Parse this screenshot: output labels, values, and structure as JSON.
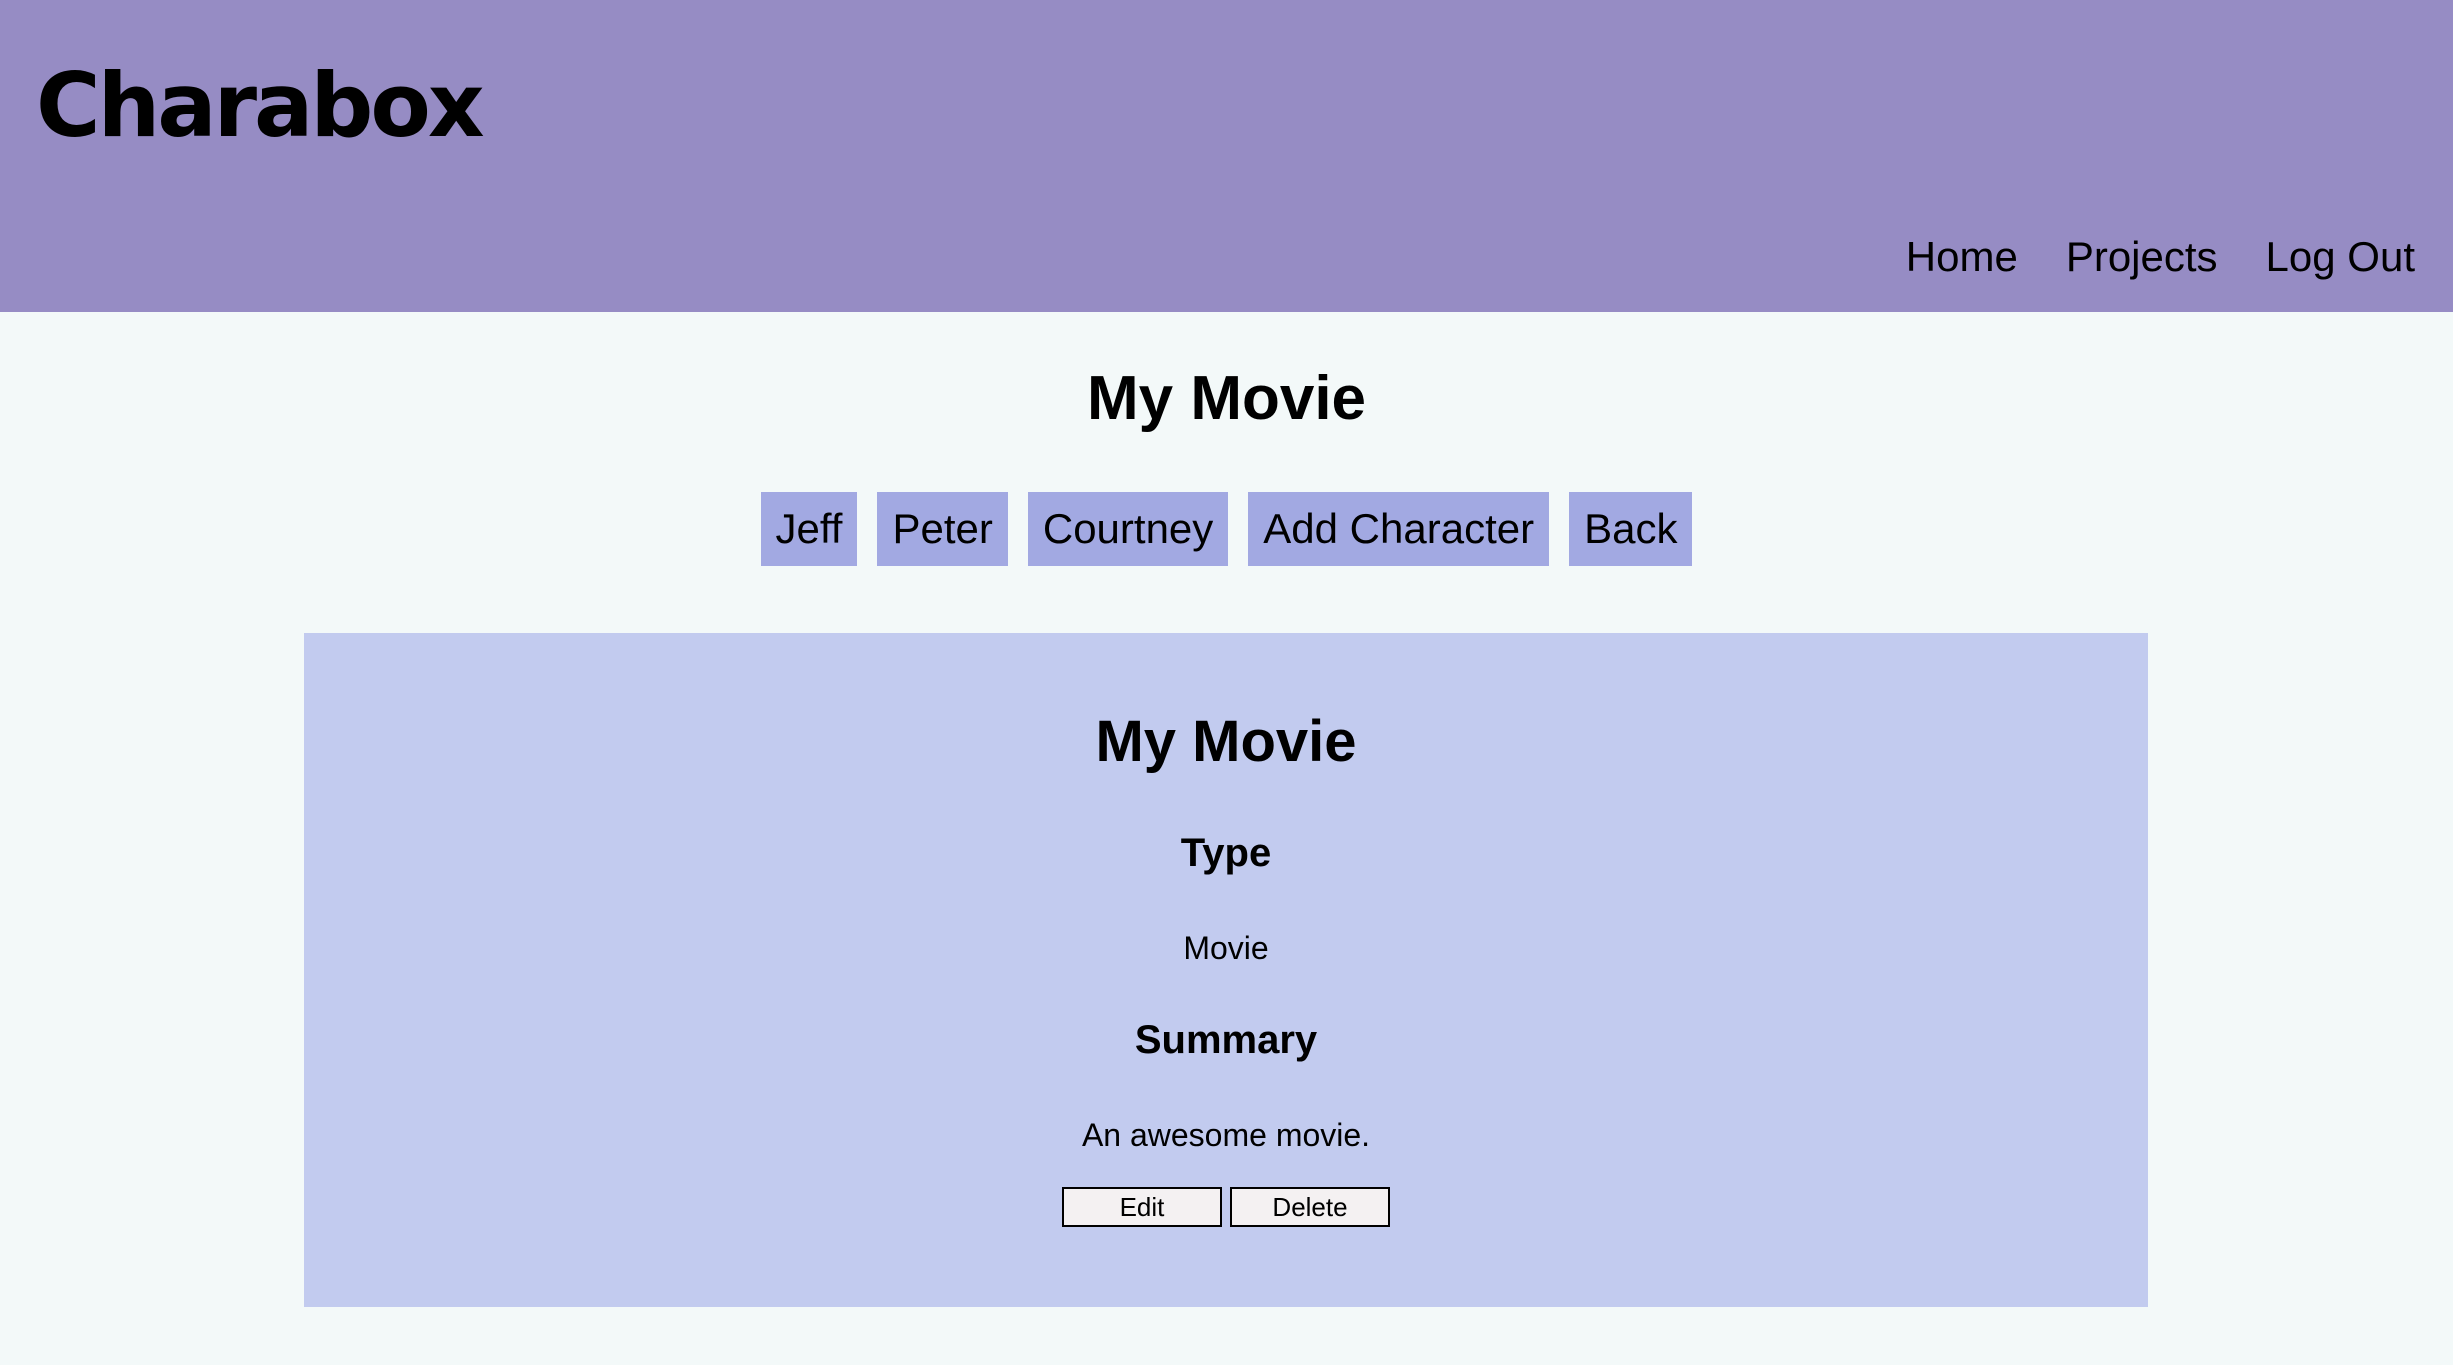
{
  "header": {
    "logo": "Charabox",
    "nav": [
      "Home",
      "Projects",
      "Log Out"
    ]
  },
  "page": {
    "title": "My Movie"
  },
  "characters": {
    "items": [
      "Jeff",
      "Peter",
      "Courtney"
    ],
    "add_label": "Add Character",
    "back_label": "Back"
  },
  "project": {
    "title": "My Movie",
    "type_label": "Type",
    "type_value": "Movie",
    "summary_label": "Summary",
    "summary_value": "An awesome movie.",
    "edit_label": "Edit",
    "delete_label": "Delete"
  },
  "colors": {
    "header_bg": "#968cc4",
    "page_bg": "#f3f9f9",
    "button_bg": "#a2a9e2",
    "card_bg": "#c2cbef"
  }
}
